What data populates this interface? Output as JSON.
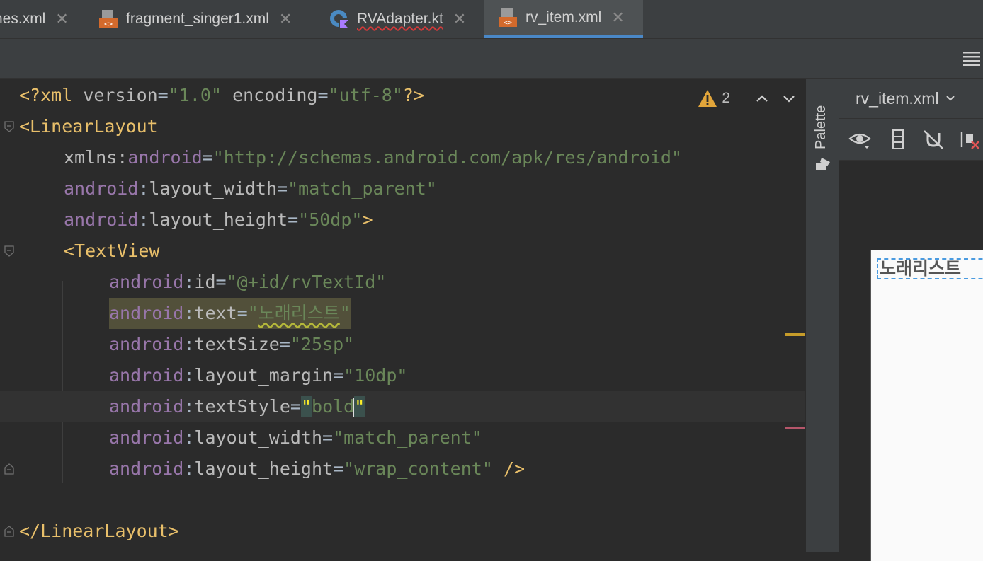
{
  "tabs": [
    {
      "label": "nes.xml",
      "type": "xml"
    },
    {
      "label": "fragment_singer1.xml",
      "type": "xml"
    },
    {
      "label": "RVAdapter.kt",
      "type": "kotlin"
    },
    {
      "label": "rv_item.xml",
      "type": "xml",
      "active": true
    }
  ],
  "editor": {
    "lines": [
      "<?xml version=\"1.0\" encoding=\"utf-8\"?>",
      "<LinearLayout",
      "xmlns:android=\"http://schemas.android.com/apk/res/android\"",
      "android:layout_width=\"match_parent\"",
      "android:layout_height=\"50dp\">",
      "<TextView",
      "android:id=\"@+id/rvTextId\"",
      "android:text=\"노래리스트\"",
      "android:textSize=\"25sp\"",
      "android:layout_margin=\"10dp\"",
      "android:textStyle=\"bold\"",
      "android:layout_width=\"match_parent\"",
      "android:layout_height=\"wrap_content\" />",
      "",
      "</LinearLayout>"
    ],
    "warnings": {
      "count": "2"
    }
  },
  "palette": {
    "label": "Palette"
  },
  "preview": {
    "file": "rv_item.xml",
    "text": "노래리스트"
  },
  "colors": {
    "accent": "#4a88c7",
    "tag": "#e8bf6a",
    "namespace": "#9876aa",
    "string": "#6a8759",
    "warning": "#e2a53a"
  }
}
